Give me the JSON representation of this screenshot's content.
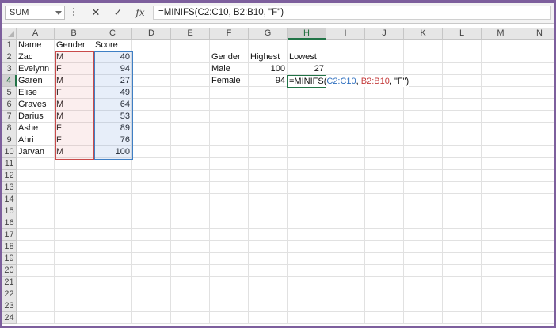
{
  "name_box": "SUM",
  "toolbar": {
    "cancel": "✕",
    "enter": "✓",
    "fx": "fx"
  },
  "formula": "=MINIFS(C2:C10, B2:B10, \"F\")",
  "columns": [
    "A",
    "B",
    "C",
    "D",
    "E",
    "F",
    "G",
    "H",
    "I",
    "J",
    "K",
    "L",
    "M",
    "N"
  ],
  "rows": [
    "1",
    "2",
    "3",
    "4",
    "5",
    "6",
    "7",
    "8",
    "9",
    "10",
    "11",
    "12",
    "13",
    "14",
    "15",
    "16",
    "17",
    "18",
    "19",
    "20",
    "21",
    "22",
    "23",
    "24"
  ],
  "table": {
    "headers": [
      "Name",
      "Gender",
      "Score"
    ],
    "rows": [
      [
        "Zac",
        "M",
        "40"
      ],
      [
        "Evelynn",
        "F",
        "94"
      ],
      [
        "Garen",
        "M",
        "27"
      ],
      [
        "Elise",
        "F",
        "49"
      ],
      [
        "Graves",
        "M",
        "64"
      ],
      [
        "Darius",
        "M",
        "53"
      ],
      [
        "Ashe",
        "F",
        "89"
      ],
      [
        "Ahri",
        "F",
        "76"
      ],
      [
        "Jarvan",
        "M",
        "100"
      ]
    ]
  },
  "summary": {
    "headers": [
      "Gender",
      "Highest",
      "Lowest"
    ],
    "male": {
      "label": "Male",
      "highest": "100",
      "lowest": "27"
    },
    "female": {
      "label": "Female",
      "highest": "94"
    }
  },
  "edit": {
    "prefix": "=MINIFS(",
    "ref1": "C2:C10",
    "comma1": ", ",
    "ref2": "B2:B10",
    "suffix": ", \"F\")"
  },
  "colors": {
    "accent": "#217346",
    "ref_blue": "#3f7fc4",
    "ref_red": "#c94a4a",
    "frame": "#7d5f9d"
  }
}
